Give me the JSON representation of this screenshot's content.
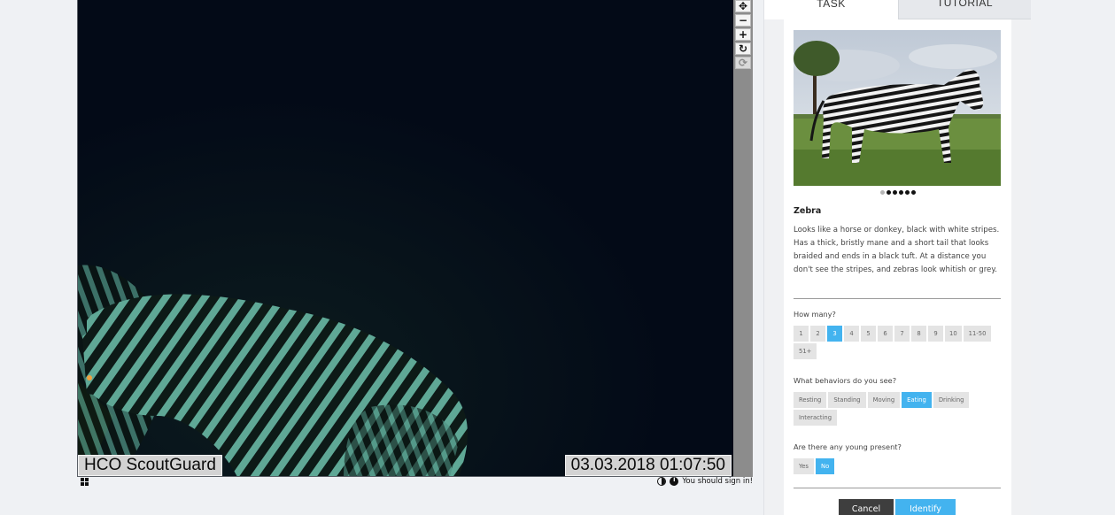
{
  "viewer": {
    "stamp_brand": "HCO ScoutGuard",
    "stamp_datetime": "03.03.2018 01:07:50",
    "controls": [
      "move-icon",
      "zoom-out-icon",
      "zoom-in-icon",
      "rotate-icon",
      "reset-icon"
    ],
    "signin_text": "You should sign in!"
  },
  "tabs": [
    {
      "label": "TASK",
      "active": true
    },
    {
      "label": "TUTORIAL",
      "active": false
    }
  ],
  "species": {
    "name": "Zebra",
    "description": "Looks like a horse or donkey, black with white stripes. Has a thick, bristly mane and a short tail that looks braided and ends in a black tuft. At a distance you don't see the stripes, and zebras look whitish or grey."
  },
  "questions": {
    "how_many": {
      "label": "How many?",
      "options": [
        "1",
        "2",
        "3",
        "4",
        "5",
        "6",
        "7",
        "8",
        "9",
        "10",
        "11-50",
        "51+"
      ],
      "selected": "3"
    },
    "behaviors": {
      "label": "What behaviors do you see?",
      "options": [
        "Resting",
        "Standing",
        "Moving",
        "Eating",
        "Drinking",
        "Interacting"
      ],
      "selected": "Eating"
    },
    "young": {
      "label": "Are there any young present?",
      "options": [
        "Yes",
        "No"
      ],
      "selected": "No"
    }
  },
  "actions": {
    "cancel": "Cancel",
    "identify": "Identify"
  },
  "colors": {
    "accent": "#43b3ef",
    "cancel_bg": "#3e3e3e",
    "night_bg": "#030a17"
  }
}
